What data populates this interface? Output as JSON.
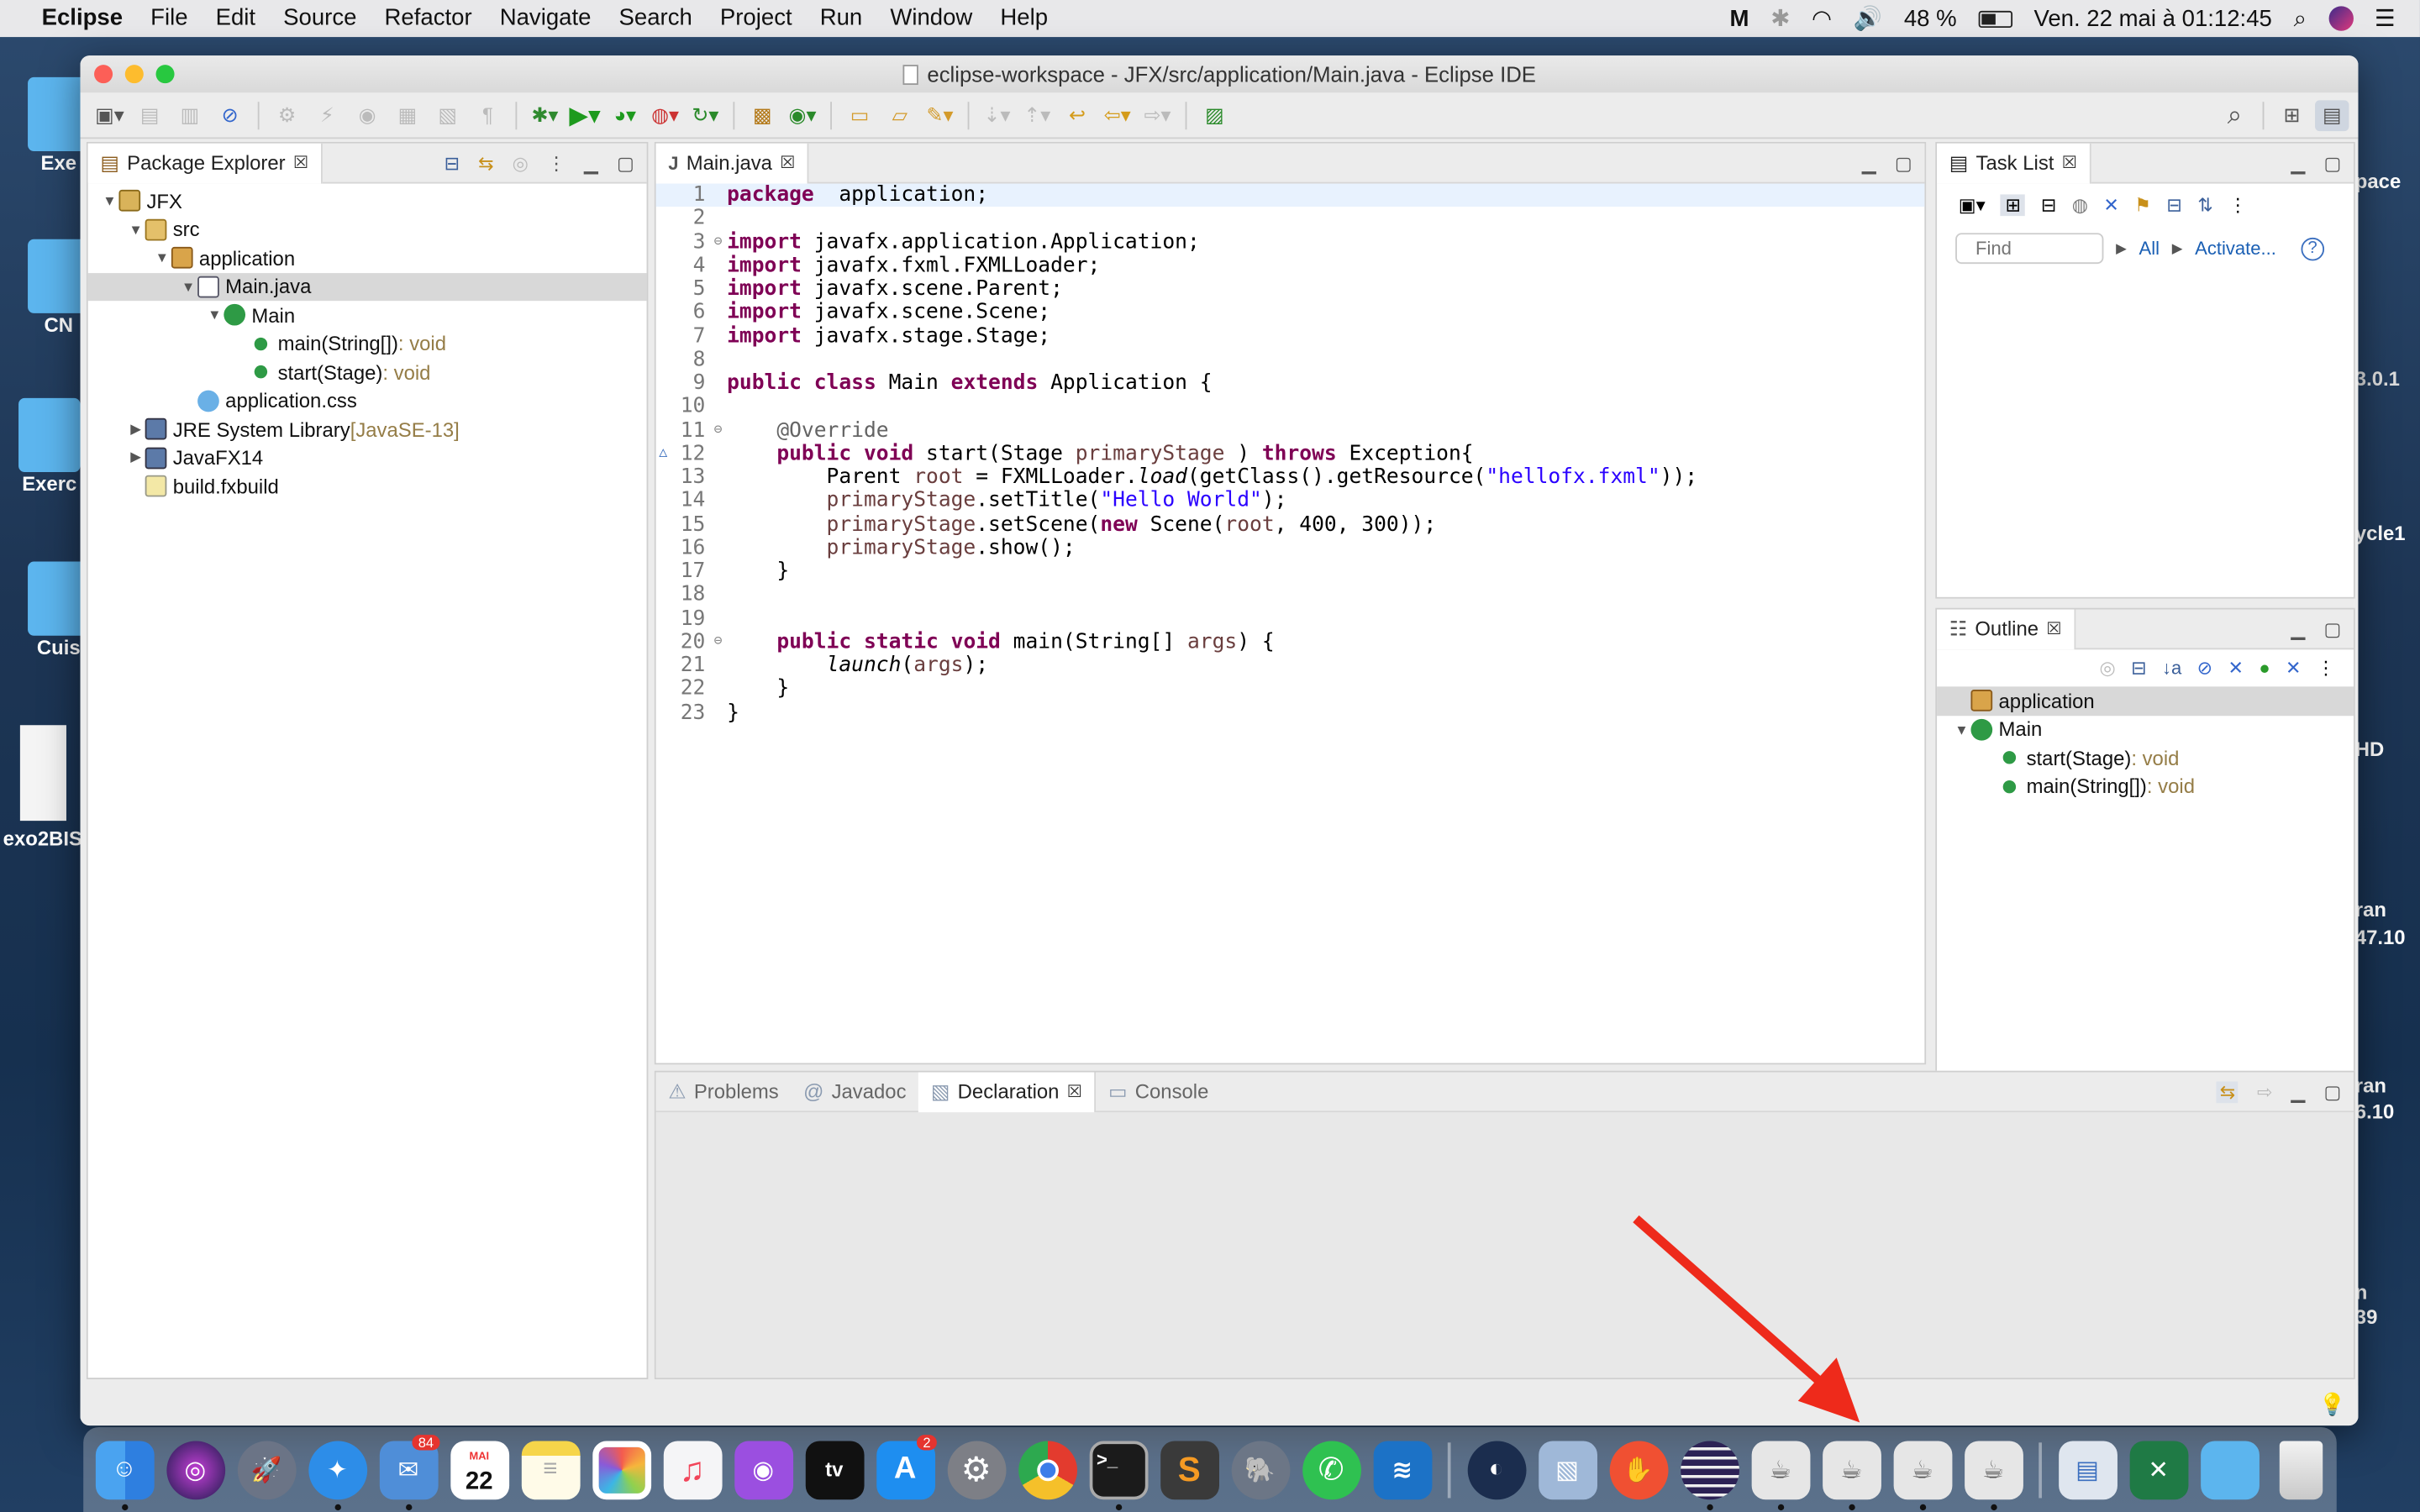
{
  "menubar": {
    "app": "Eclipse",
    "items": [
      "File",
      "Edit",
      "Source",
      "Refactor",
      "Navigate",
      "Search",
      "Project",
      "Run",
      "Window",
      "Help"
    ],
    "battery": "48 %",
    "clock": "Ven. 22 mai à  01:12:45"
  },
  "desktop": {
    "left": [
      "Exe",
      "CN",
      "Exerc",
      "Cuis",
      "exo2BIS"
    ],
    "right": [
      "pace",
      "3.0.1",
      "ycle1",
      "HD",
      "ran",
      "47.10",
      "ran",
      "6.10",
      "n",
      "39"
    ]
  },
  "window": {
    "title": "eclipse-workspace - JFX/src/application/Main.java - Eclipse IDE"
  },
  "package_explorer": {
    "tab": "Package Explorer",
    "tree": [
      {
        "label": "JFX",
        "depth": 0,
        "tw": "▼",
        "icon": "project-icon"
      },
      {
        "label": "src",
        "depth": 1,
        "tw": "▼",
        "icon": "source-folder-icon"
      },
      {
        "label": "application",
        "depth": 2,
        "tw": "▼",
        "icon": "package-icon"
      },
      {
        "label": "Main.java",
        "depth": 3,
        "tw": "▼",
        "icon": "java-file-icon",
        "selected": true
      },
      {
        "label": "Main",
        "depth": 4,
        "tw": "▼",
        "icon": "class-icon"
      },
      {
        "label": "main(String[])",
        "suffix": " : void",
        "depth": 5,
        "tw": "",
        "icon": "static-method-icon"
      },
      {
        "label": "start(Stage)",
        "suffix": " : void",
        "depth": 5,
        "tw": "",
        "icon": "method-icon"
      },
      {
        "label": "application.css",
        "depth": 3,
        "tw": "",
        "icon": "css-file-icon"
      },
      {
        "label": "JRE System Library",
        "suffix": " [JavaSE-13]",
        "depth": 1,
        "tw": "▶",
        "icon": "library-icon"
      },
      {
        "label": "JavaFX14",
        "depth": 1,
        "tw": "▶",
        "icon": "library-icon"
      },
      {
        "label": "build.fxbuild",
        "depth": 1,
        "tw": "",
        "icon": "build-file-icon"
      }
    ]
  },
  "editor": {
    "tab": "Main.java",
    "lines": [
      [
        [
          "kw",
          "package"
        ],
        [
          "",
          "  application;"
        ]
      ],
      [],
      [
        [
          "kw",
          "import"
        ],
        [
          "",
          " javafx.application.Application;"
        ]
      ],
      [
        [
          "kw",
          "import"
        ],
        [
          "",
          " javafx.fxml.FXMLLoader;"
        ]
      ],
      [
        [
          "kw",
          "import"
        ],
        [
          "",
          " javafx.scene.Parent;"
        ]
      ],
      [
        [
          "kw",
          "import"
        ],
        [
          "",
          " javafx.scene.Scene;"
        ]
      ],
      [
        [
          "kw",
          "import"
        ],
        [
          "",
          " javafx.stage.Stage;"
        ]
      ],
      [],
      [
        [
          "kw",
          "public"
        ],
        [
          "",
          " "
        ],
        [
          "kw",
          "class"
        ],
        [
          "",
          " Main "
        ],
        [
          "kw",
          "extends"
        ],
        [
          "",
          " Application {"
        ]
      ],
      [],
      [
        [
          "",
          "    "
        ],
        [
          "ann",
          "@Override"
        ]
      ],
      [
        [
          "",
          "    "
        ],
        [
          "kw",
          "public"
        ],
        [
          "",
          " "
        ],
        [
          "kw",
          "void"
        ],
        [
          "",
          " start(Stage "
        ],
        [
          "var",
          "primaryStage"
        ],
        [
          "",
          " ) "
        ],
        [
          "kw",
          "throws"
        ],
        [
          "",
          " Exception{"
        ]
      ],
      [
        [
          "",
          "        Parent "
        ],
        [
          "var",
          "root"
        ],
        [
          "",
          " = FXMLLoader."
        ],
        [
          "it",
          "load"
        ],
        [
          "",
          "(getClass().getResource("
        ],
        [
          "str",
          "\"hellofx.fxml\""
        ],
        [
          "",
          "));"
        ]
      ],
      [
        [
          "",
          "        "
        ],
        [
          "var",
          "primaryStage"
        ],
        [
          "",
          ".setTitle("
        ],
        [
          "str",
          "\"Hello World\""
        ],
        [
          "",
          ");"
        ]
      ],
      [
        [
          "",
          "        "
        ],
        [
          "var",
          "primaryStage"
        ],
        [
          "",
          ".setScene("
        ],
        [
          "kw",
          "new"
        ],
        [
          "",
          " Scene("
        ],
        [
          "var",
          "root"
        ],
        [
          "",
          ", 400, 300));"
        ]
      ],
      [
        [
          "",
          "        "
        ],
        [
          "var",
          "primaryStage"
        ],
        [
          "",
          ".show();"
        ]
      ],
      [
        [
          "",
          "    }"
        ]
      ],
      [],
      [],
      [
        [
          "",
          "    "
        ],
        [
          "kw",
          "public"
        ],
        [
          "",
          " "
        ],
        [
          "kw",
          "static"
        ],
        [
          "",
          " "
        ],
        [
          "kw",
          "void"
        ],
        [
          "",
          " main(String[] "
        ],
        [
          "var",
          "args"
        ],
        [
          "",
          ") {"
        ]
      ],
      [
        [
          "",
          "        "
        ],
        [
          "it",
          "launch"
        ],
        [
          "",
          "("
        ],
        [
          "var",
          "args"
        ],
        [
          "",
          ");"
        ]
      ],
      [
        [
          "",
          "    }"
        ]
      ],
      [
        [
          "",
          "}"
        ]
      ]
    ]
  },
  "task_list": {
    "tab": "Task List",
    "find_placeholder": "Find",
    "all": "All",
    "activate": "Activate..."
  },
  "outline": {
    "tab": "Outline",
    "items": [
      {
        "label": "application",
        "depth": 0,
        "icon": "package-icon",
        "selected": true
      },
      {
        "label": "Main",
        "depth": 0,
        "tw": "▼",
        "icon": "class-icon"
      },
      {
        "label": "start(Stage)",
        "suffix": " : void",
        "depth": 1,
        "icon": "method-icon"
      },
      {
        "label": "main(String[])",
        "suffix": " : void",
        "depth": 1,
        "icon": "static-method-icon"
      }
    ]
  },
  "bottom": {
    "tabs": [
      {
        "label": "Problems",
        "active": false
      },
      {
        "label": "Javadoc",
        "active": false
      },
      {
        "label": "Declaration",
        "active": true
      },
      {
        "label": "Console",
        "active": false
      }
    ]
  },
  "dock": {
    "mail_badge": "84",
    "calendar_month": "MAI",
    "calendar_day": "22",
    "appstore_badge": "2",
    "tv_label": "tv"
  },
  "colors": {
    "accent": "#ee2a1b",
    "selection": "#d8d8d8",
    "keyword": "#7f0055",
    "string": "#2a00ff"
  }
}
